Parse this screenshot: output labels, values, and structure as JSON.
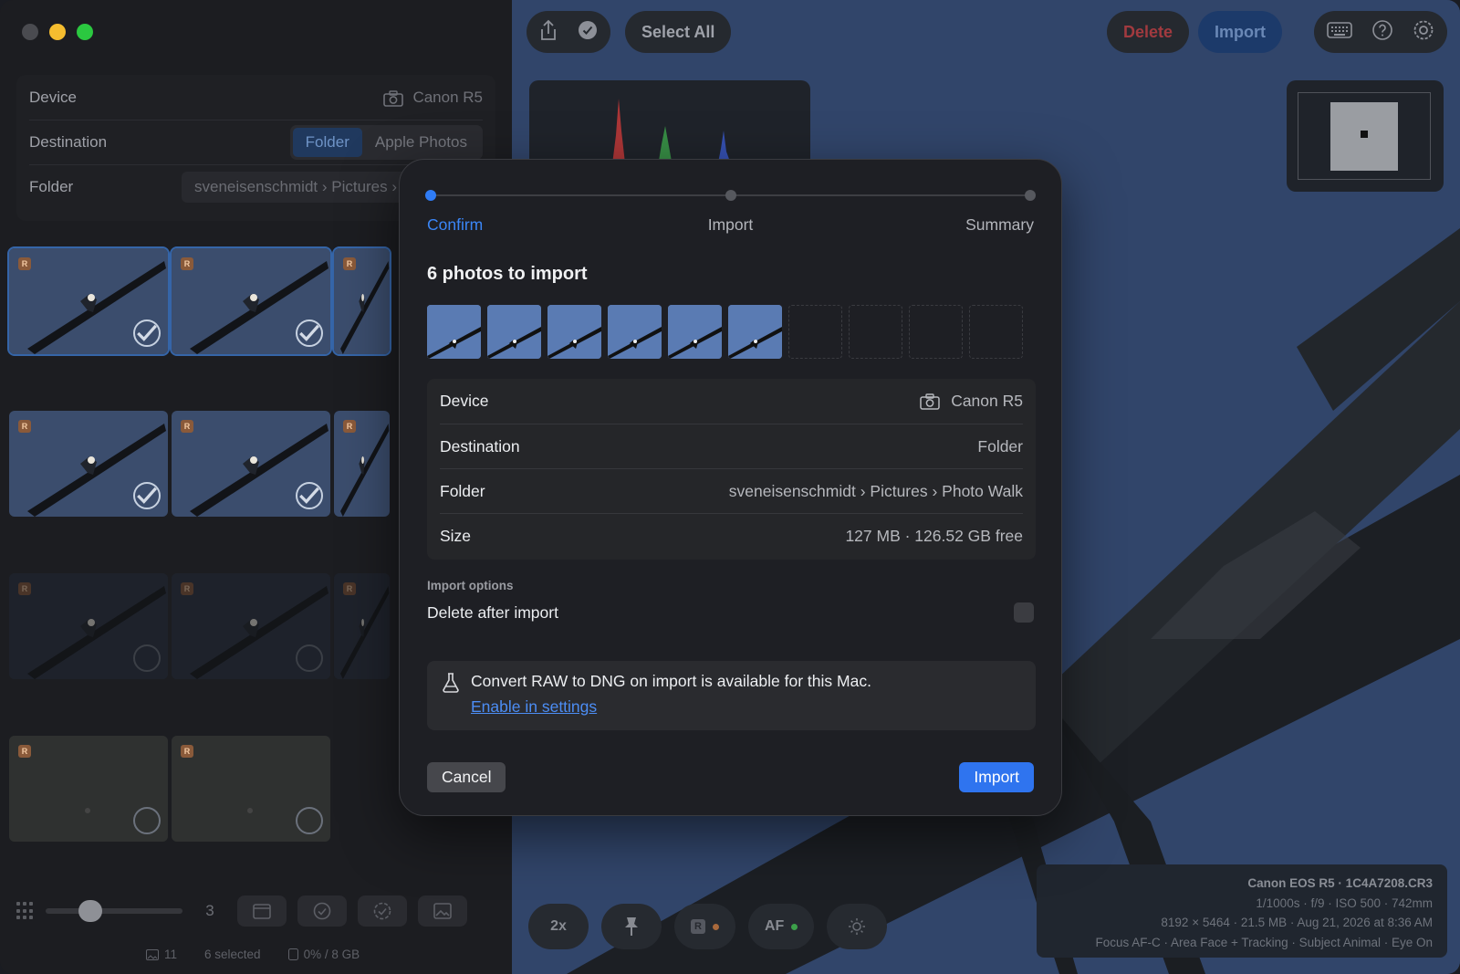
{
  "sidebar": {
    "device_label": "Device",
    "device_value": "Canon R5",
    "destination_label": "Destination",
    "destination_options": [
      "Folder",
      "Apple Photos"
    ],
    "destination_selected": "Folder",
    "folder_label": "Folder",
    "folder_path": "sveneisenschmidt › Pictures › Pho",
    "raw_badge": "R",
    "thumb_size_value": "3",
    "status": {
      "count": "11",
      "selected": "6 selected",
      "storage": "0% / 8 GB"
    }
  },
  "toolbar": {
    "select_all": "Select All",
    "delete": "Delete",
    "import": "Import"
  },
  "preview_tools": {
    "zoom": "2x",
    "raw_badge": "R",
    "af": "AF"
  },
  "exif": {
    "line1": "Canon EOS R5 · 1C4A7208.CR3",
    "line2": "1/1000s · f/9 · ISO 500 · 742mm",
    "line3": "8192 × 5464 · 21.5 MB · Aug 21, 2026 at 8:36 AM",
    "line4": "Focus AF-C · Area Face + Tracking · Subject Animal · Eye On"
  },
  "modal": {
    "steps": [
      "Confirm",
      "Import",
      "Summary"
    ],
    "active_step": "Confirm",
    "title": "6 photos to import",
    "details": [
      {
        "key": "Device",
        "value": "Canon R5"
      },
      {
        "key": "Destination",
        "value": "Folder"
      },
      {
        "key": "Folder",
        "value": "sveneisenschmidt › Pictures › Photo Walk"
      },
      {
        "key": "Size",
        "value": "127 MB · 126.52 GB free"
      }
    ],
    "options_label": "Import options",
    "delete_after_import": "Delete after import",
    "delete_after_import_checked": false,
    "note": "Convert RAW to DNG on import is available for this Mac.",
    "note_link": "Enable in settings",
    "cancel": "Cancel",
    "import": "Import"
  },
  "colors": {
    "accent": "#2f74ef",
    "danger": "#a13a3f",
    "sky": "#3b4d6d"
  }
}
